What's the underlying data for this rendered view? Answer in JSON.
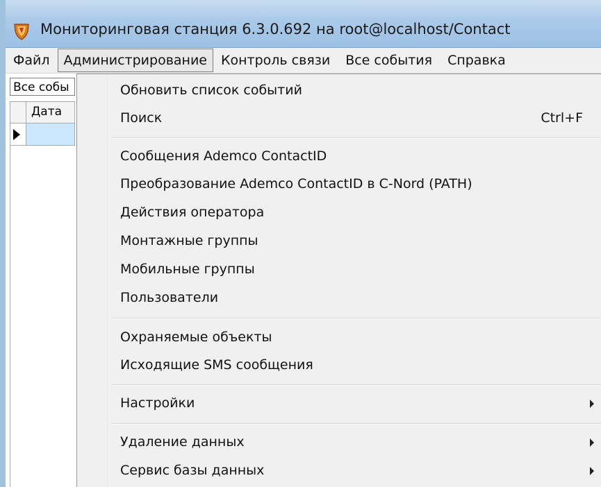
{
  "window": {
    "title": "Мониторинговая станция 6.3.0.692 на root@localhost/Contact"
  },
  "menubar": {
    "items": [
      {
        "label": "Файл"
      },
      {
        "label": "Администрирование"
      },
      {
        "label": "Контроль связи"
      },
      {
        "label": "Все события"
      },
      {
        "label": "Справка"
      }
    ]
  },
  "toolbar": {
    "filter_value": "Все собы"
  },
  "grid": {
    "column_date": "Дата"
  },
  "dropdown": {
    "items": [
      {
        "label": "Обновить список событий"
      },
      {
        "label": "Поиск",
        "shortcut": "Ctrl+F"
      },
      {
        "label": "Сообщения Ademco ContactID"
      },
      {
        "label": "Преобразование Ademco ContactID в C-Nord (PATH)"
      },
      {
        "label": "Действия оператора"
      },
      {
        "label": "Монтажные группы"
      },
      {
        "label": "Мобильные группы"
      },
      {
        "label": "Пользователи"
      },
      {
        "label": "Охраняемые объекты"
      },
      {
        "label": "Исходящие SMS сообщения"
      },
      {
        "label": "Настройки"
      },
      {
        "label": "Удаление данных"
      },
      {
        "label": "Сервис базы данных"
      }
    ]
  },
  "icons": {
    "app": "shield-icon",
    "submenu": "chevron-right-icon",
    "row_indicator": "row-pointer-icon"
  },
  "colors": {
    "titlebar": "#a9c9e8",
    "menu_bg": "#f0f0f0",
    "selection": "#cce8ff"
  }
}
